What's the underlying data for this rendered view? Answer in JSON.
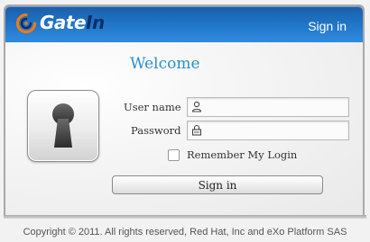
{
  "header": {
    "logo_text_main": "Gate",
    "logo_text_accent": "In",
    "signin_link": "Sign in"
  },
  "login": {
    "title": "Welcome",
    "username_label": "User name",
    "username_value": "",
    "password_label": "Password",
    "password_value": "",
    "remember_label": "Remember My Login",
    "remember_checked": false,
    "signin_button": "Sign in"
  },
  "footer": {
    "copyright": "Copyright © 2011. All rights reserved, Red Hat, Inc and eXo Platform SAS"
  },
  "icons": {
    "logo": "gatein-logo-icon",
    "keyhole": "keyhole-icon",
    "user": "user-icon",
    "password": "lock-icon"
  },
  "colors": {
    "header_blue": "#1f73c4",
    "welcome_blue": "#2a8fd0",
    "logo_orange": "#f07a12"
  }
}
